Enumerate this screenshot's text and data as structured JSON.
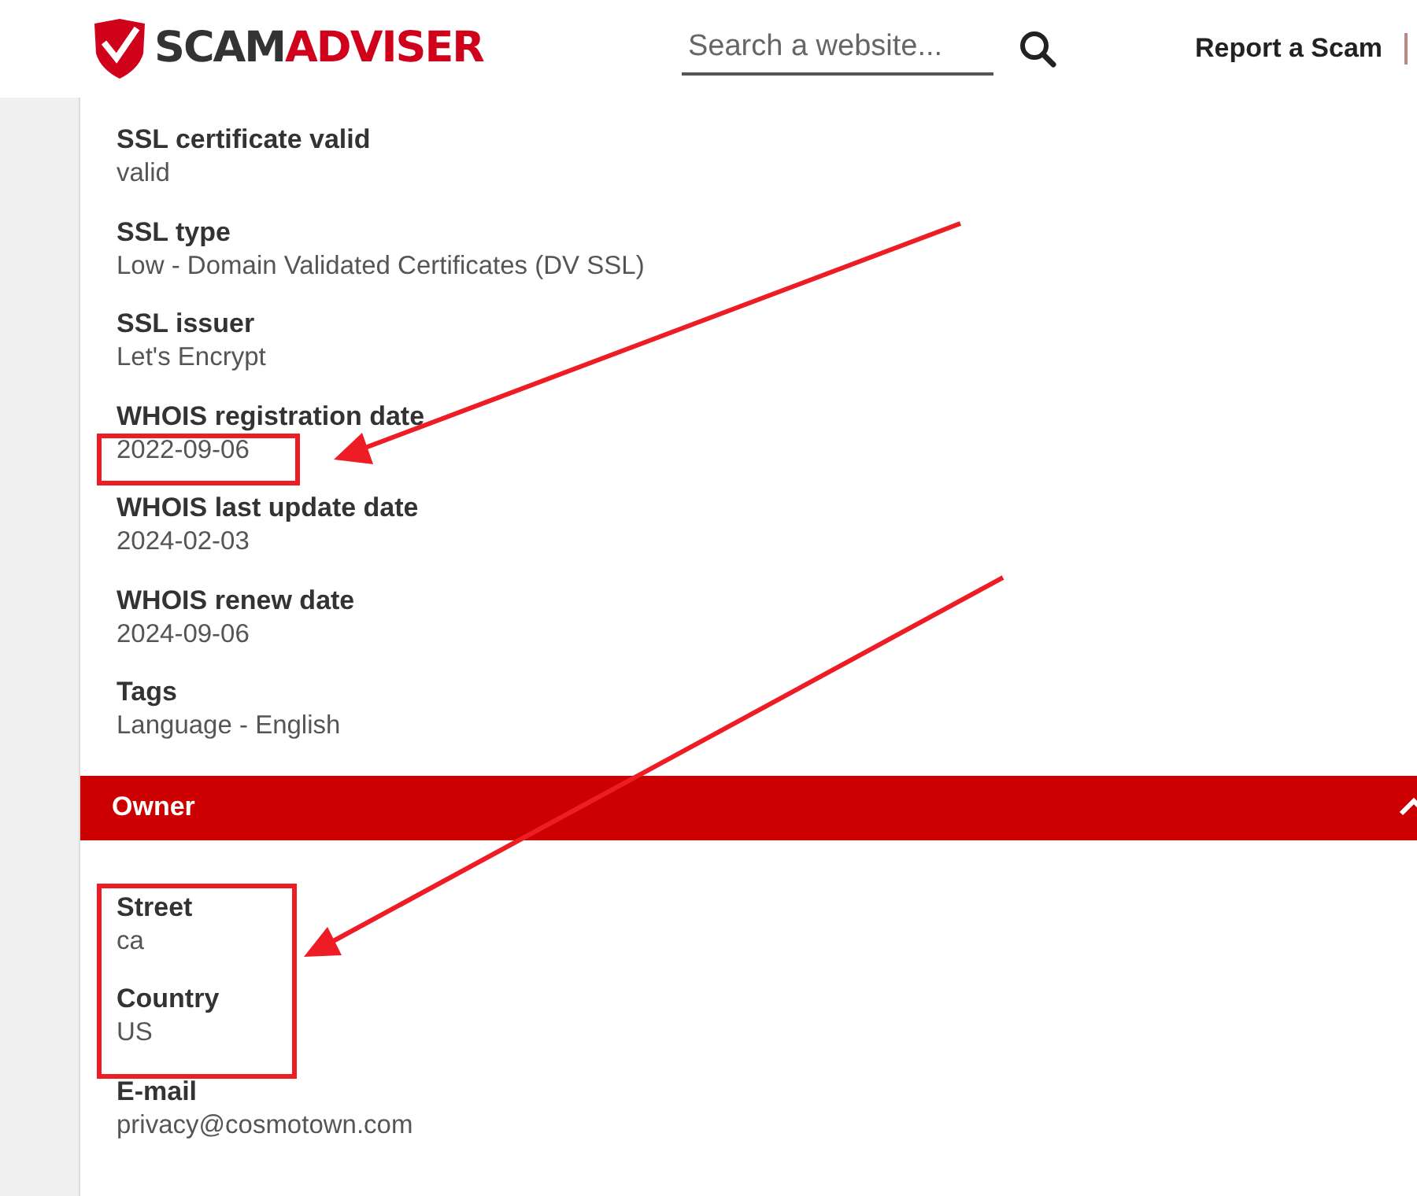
{
  "header": {
    "logo": {
      "part_1": "SCAM",
      "part_2": "ADVISER"
    },
    "search": {
      "placeholder": "Search a website..."
    },
    "nav_link": "Report a Scam"
  },
  "fields": [
    {
      "label": "SSL certificate valid",
      "value": "valid"
    },
    {
      "label": "SSL type",
      "value": "Low - Domain Validated Certificates (DV SSL)"
    },
    {
      "label": "SSL issuer",
      "value": "Let's Encrypt"
    },
    {
      "label": "WHOIS registration date",
      "value": "2022-09-06"
    },
    {
      "label": "WHOIS last update date",
      "value": "2024-02-03"
    },
    {
      "label": "WHOIS renew date",
      "value": "2024-09-06"
    },
    {
      "label": "Tags",
      "value": "Language - English"
    }
  ],
  "owner_section": {
    "title": "Owner",
    "expanded": true,
    "fields": [
      {
        "label": "Street",
        "value": "ca"
      },
      {
        "label": "Country",
        "value": "US"
      },
      {
        "label": "E-mail",
        "value": "privacy@cosmotown.com"
      }
    ]
  }
}
